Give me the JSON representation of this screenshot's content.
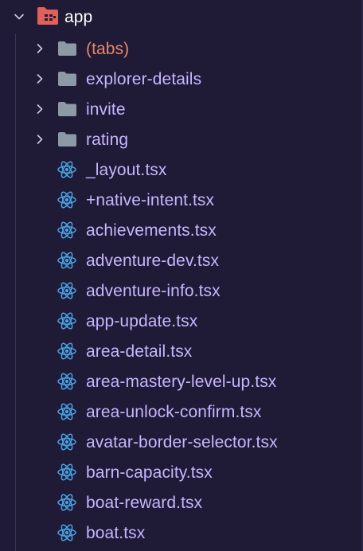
{
  "explorer": {
    "root": {
      "label": "app",
      "expanded": true,
      "icon": "folder-app-open-icon"
    },
    "folders": [
      {
        "label": "(tabs)",
        "icon": "folder-icon",
        "highlight": true
      },
      {
        "label": "explorer-details",
        "icon": "folder-icon"
      },
      {
        "label": "invite",
        "icon": "folder-icon"
      },
      {
        "label": "rating",
        "icon": "folder-icon"
      }
    ],
    "files": [
      {
        "label": "_layout.tsx",
        "icon": "react-icon"
      },
      {
        "label": "+native-intent.tsx",
        "icon": "react-icon"
      },
      {
        "label": "achievements.tsx",
        "icon": "react-icon"
      },
      {
        "label": "adventure-dev.tsx",
        "icon": "react-icon"
      },
      {
        "label": "adventure-info.tsx",
        "icon": "react-icon"
      },
      {
        "label": "app-update.tsx",
        "icon": "react-icon"
      },
      {
        "label": "area-detail.tsx",
        "icon": "react-icon"
      },
      {
        "label": "area-mastery-level-up.tsx",
        "icon": "react-icon"
      },
      {
        "label": "area-unlock-confirm.tsx",
        "icon": "react-icon"
      },
      {
        "label": "avatar-border-selector.tsx",
        "icon": "react-icon"
      },
      {
        "label": "barn-capacity.tsx",
        "icon": "react-icon"
      },
      {
        "label": "boat-reward.tsx",
        "icon": "react-icon"
      },
      {
        "label": "boat.tsx",
        "icon": "react-icon"
      }
    ]
  },
  "colors": {
    "background": "#1f1a35",
    "label": "#c6b6ff",
    "highlight_label": "#e8876a",
    "root_label": "#ffffff",
    "folder": "#8c99a6",
    "react": "#4aa3e6",
    "app_folder": "#e0605a"
  }
}
